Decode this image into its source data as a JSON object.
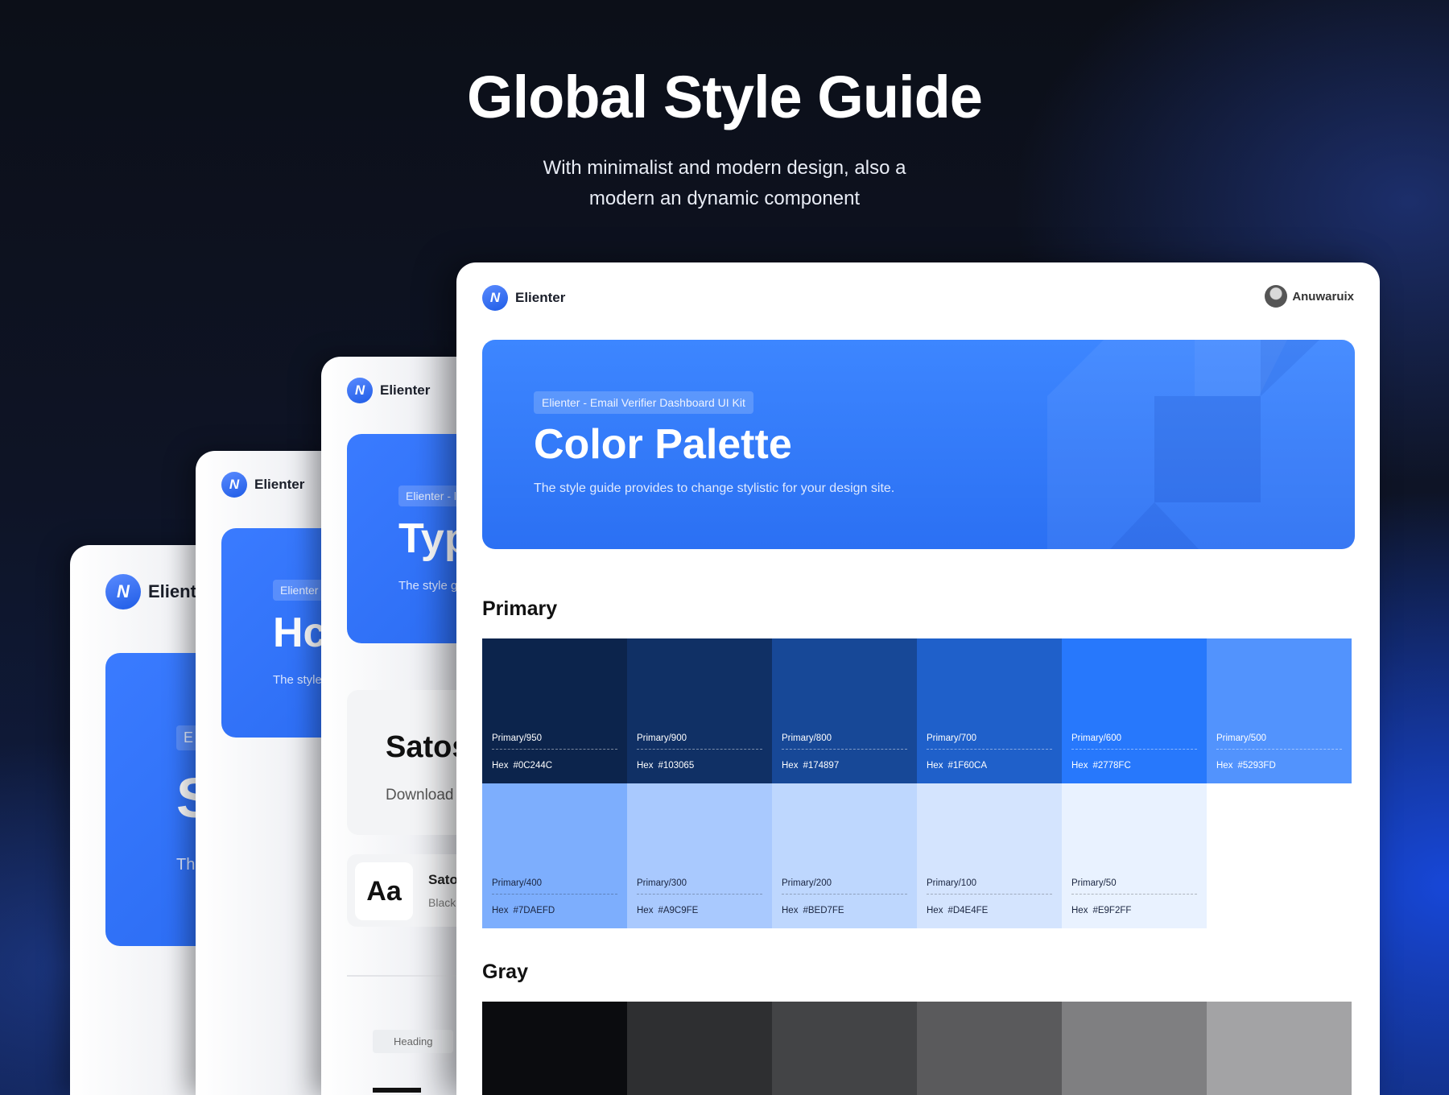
{
  "hero": {
    "title": "Global Style Guide",
    "subtitle_line1": "With minimalist and modern design, also a",
    "subtitle_line2": "modern an dynamic component"
  },
  "brand": {
    "name": "Elienter",
    "logo_icon": "elienter-logo-icon",
    "accent": "#2778FC"
  },
  "back_cards": {
    "card1": {
      "logo_text": "Elient",
      "chip": "E",
      "title": "S",
      "desc": "Th"
    },
    "card2": {
      "logo_text": "Elienter",
      "chip": "Elienter",
      "title": "Hc",
      "desc": "The style"
    },
    "card3": {
      "logo_text": "Elienter",
      "chip": "Elienter - l",
      "title": "Typ",
      "desc": "The style g",
      "font_name": "Satos",
      "download": "Download",
      "aa": "Aa",
      "font_small": "Sato",
      "font_weight": "Black",
      "heading_chip": "Heading"
    }
  },
  "main": {
    "user_name": "Anuwaruix",
    "banner": {
      "chip": "Elienter - Email Verifier Dashboard UI Kit",
      "title": "Color Palette",
      "desc": "The style guide provides to change stylistic for your design site."
    },
    "primary_title": "Primary",
    "gray_title": "Gray",
    "hex_prefix": "Hex",
    "primary": [
      {
        "name": "Primary/950",
        "hex": "#0C244C",
        "color": "#0C244C",
        "text": "#ffffff"
      },
      {
        "name": "Primary/900",
        "hex": "#103065",
        "color": "#103065",
        "text": "#ffffff"
      },
      {
        "name": "Primary/800",
        "hex": "#174897",
        "color": "#174897",
        "text": "#ffffff"
      },
      {
        "name": "Primary/700",
        "hex": "#1F60CA",
        "color": "#1F60CA",
        "text": "#ffffff"
      },
      {
        "name": "Primary/600",
        "hex": "#2778FC",
        "color": "#2778FC",
        "text": "#ffffff"
      },
      {
        "name": "Primary/500",
        "hex": "#5293FD",
        "color": "#5293FD",
        "text": "#ffffff"
      },
      {
        "name": "Primary/400",
        "hex": "#7DAEFD",
        "color": "#7DAEFD",
        "text": "#1a2540"
      },
      {
        "name": "Primary/300",
        "hex": "#A9C9FE",
        "color": "#A9C9FE",
        "text": "#1a2540"
      },
      {
        "name": "Primary/200",
        "hex": "#BED7FE",
        "color": "#BED7FE",
        "text": "#1a2540"
      },
      {
        "name": "Primary/100",
        "hex": "#D4E4FE",
        "color": "#D4E4FE",
        "text": "#1a2540"
      },
      {
        "name": "Primary/50",
        "hex": "#E9F2FF",
        "color": "#E9F2FF",
        "text": "#1a2540"
      }
    ],
    "gray_colors": [
      "#0B0C0F",
      "#2E2F31",
      "#434446",
      "#5A5A5C",
      "#7F7F81",
      "#A3A3A5"
    ]
  }
}
